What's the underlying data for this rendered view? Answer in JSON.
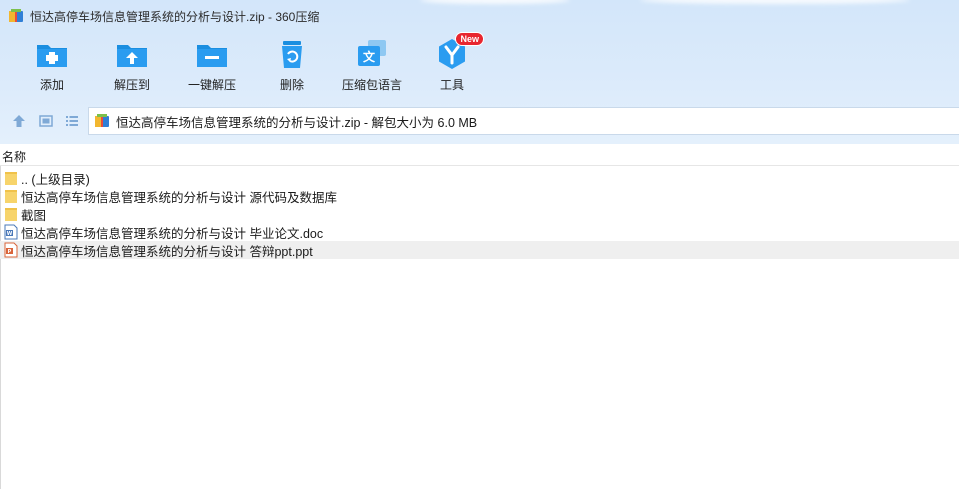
{
  "window": {
    "title": "恒达高停车场信息管理系统的分析与设计.zip - 360压缩",
    "app_icon": "zip-archive-icon"
  },
  "toolbar": {
    "buttons": [
      {
        "label": "添加",
        "icon": "add-folder-icon"
      },
      {
        "label": "解压到",
        "icon": "extract-to-icon"
      },
      {
        "label": "一键解压",
        "icon": "one-click-extract-icon"
      },
      {
        "label": "删除",
        "icon": "recycle-bin-icon"
      },
      {
        "label": "压缩包语言",
        "icon": "language-icon"
      },
      {
        "label": "工具",
        "icon": "tools-icon",
        "badge": "New"
      }
    ]
  },
  "nav": {
    "up_icon": "arrow-up-icon",
    "view_icon": "thumbnail-view-icon",
    "list_icon": "list-view-icon",
    "path": "恒达高停车场信息管理系统的分析与设计.zip - 解包大小为 6.0 MB"
  },
  "columns": {
    "name": "名称"
  },
  "files": [
    {
      "name": ".. (上级目录)",
      "type": "folder"
    },
    {
      "name": "恒达高停车场信息管理系统的分析与设计 源代码及数据库",
      "type": "folder"
    },
    {
      "name": "截图",
      "type": "folder"
    },
    {
      "name": "恒达高停车场信息管理系统的分析与设计 毕业论文.doc",
      "type": "doc"
    },
    {
      "name": "恒达高停车场信息管理系统的分析与设计 答辩ppt.ppt",
      "type": "ppt",
      "selected": true
    }
  ],
  "colors": {
    "header_bg": "#d3e6fa",
    "icon_blue": "#1a8ee0",
    "badge_red": "#e8262f",
    "folder_yellow": "#f7d46b",
    "selected_row": "#efefef"
  }
}
